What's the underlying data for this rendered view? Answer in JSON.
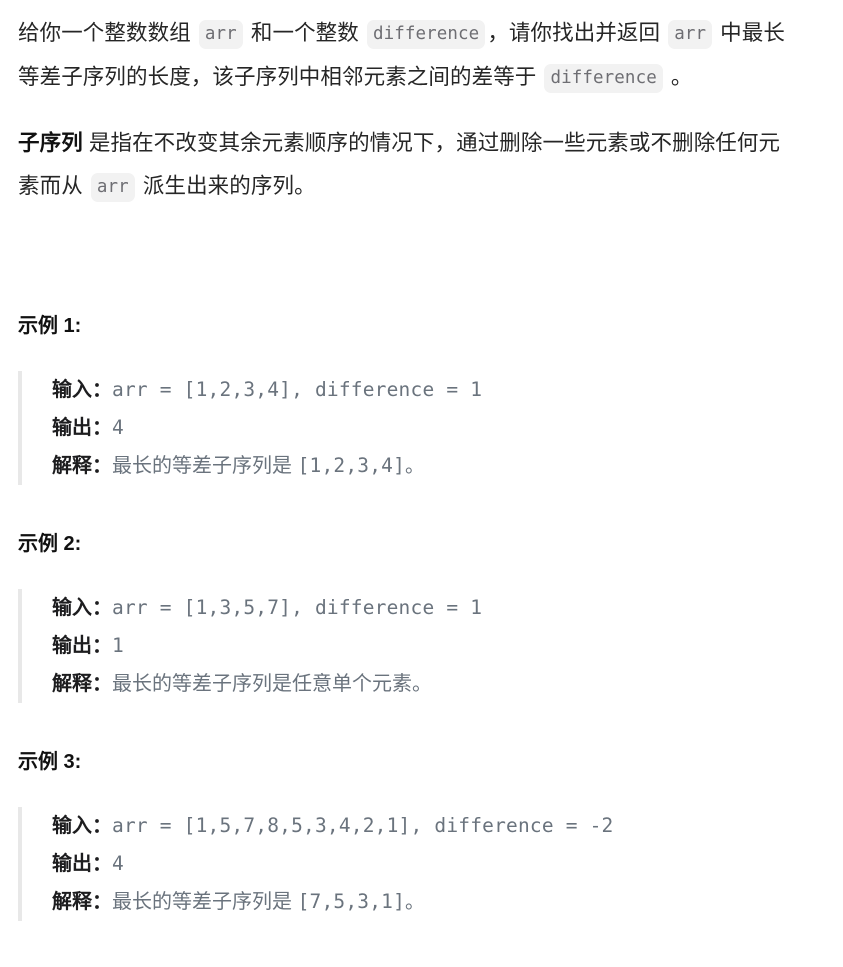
{
  "description": {
    "paragraph1": {
      "seg1": "给你一个整数数组 ",
      "code1": "arr",
      "seg2": " 和一个整数 ",
      "code2": "difference",
      "seg3": "，请你找出并返回 ",
      "code3": "arr",
      "seg4": " 中最长等差子序列的长度，该子序列中相邻元素之间的差等于 ",
      "code4": "difference",
      "seg5": " 。"
    },
    "paragraph2": {
      "bold": "子序列",
      "seg1": " 是指在不改变其余元素顺序的情况下，通过删除一些元素或不删除任何元素而从 ",
      "code1": "arr",
      "seg2": " 派生出来的序列。"
    }
  },
  "examples": [
    {
      "title": "示例 1:",
      "input_label": "输入：",
      "input_value": "arr = [1,2,3,4], difference = 1",
      "output_label": "输出：",
      "output_value": "4",
      "explain_label": "解释：",
      "explain_text": "最长的等差子序列是 ",
      "explain_code": "[1,2,3,4]。"
    },
    {
      "title": "示例 2:",
      "input_label": "输入：",
      "input_value": "arr = [1,3,5,7], difference = 1",
      "output_label": "输出：",
      "output_value": "1",
      "explain_label": "解释：",
      "explain_text": "最长的等差子序列是任意单个元素。",
      "explain_code": ""
    },
    {
      "title": "示例 3:",
      "input_label": "输入：",
      "input_value": "arr = [1,5,7,8,5,3,4,2,1], difference = -2",
      "output_label": "输出：",
      "output_value": "4",
      "explain_label": "解释：",
      "explain_text": "最长的等差子序列是 ",
      "explain_code": "[7,5,3,1]。"
    }
  ],
  "colors": {
    "text": "#262626",
    "code_text": "#6a737d",
    "chip_background": "#f2f2f2",
    "quote_border": "#e8e8e8",
    "page_background": "#ffffff"
  }
}
